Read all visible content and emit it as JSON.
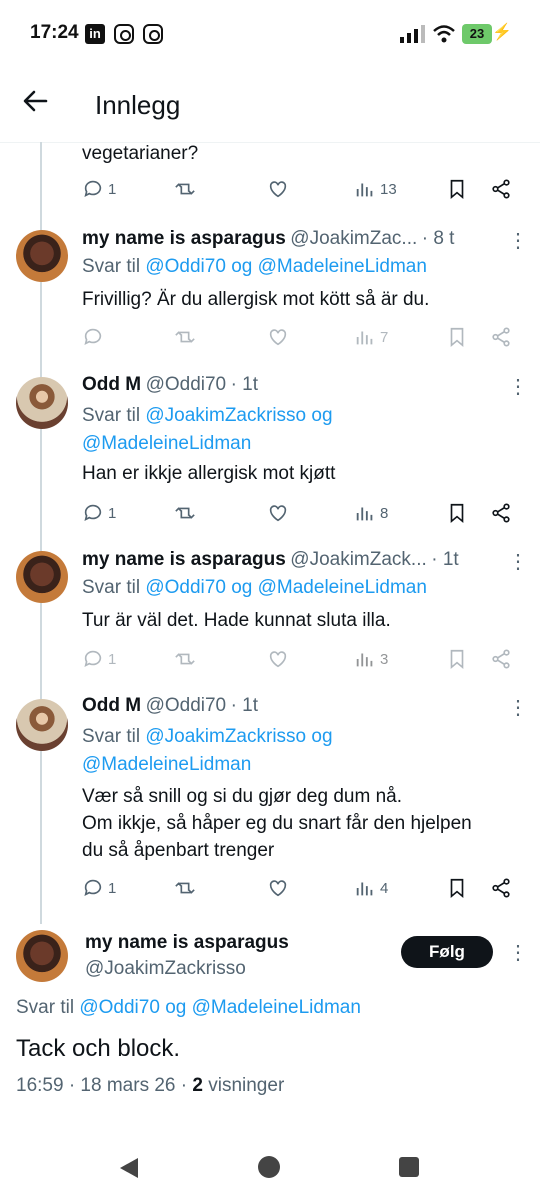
{
  "status_bar": {
    "time": "17:24",
    "app_icons": [
      "linkedin-icon",
      "instagram-icon",
      "instagram-icon"
    ],
    "battery": "23"
  },
  "header": {
    "title": "Innlegg"
  },
  "tweets": [
    {
      "text": "vegetarianer?",
      "stats": {
        "reply": "1",
        "retweet": "",
        "like": "",
        "views": "13"
      }
    },
    {
      "name": "my name is asparagus",
      "handle": "@JoakimZac...",
      "time": "· 8 t",
      "reply_prefix": "Svar til ",
      "reply_to_1": "@Oddi70",
      "reply_and": " og ",
      "reply_to_2": "@MadeleineLidman",
      "text": "Frivillig? Är du allergisk mot kött så är du.",
      "stats": {
        "reply": "",
        "retweet": "",
        "like": "",
        "views": "7"
      }
    },
    {
      "name": "Odd M",
      "handle": "@Oddi70",
      "time": "· 1t",
      "reply_prefix": "Svar til ",
      "reply_to_1": "@JoakimZackrisso",
      "reply_and": " og",
      "reply_to_2": "@MadeleineLidman",
      "text": "Han er ikkje allergisk mot kjøtt",
      "stats": {
        "reply": "1",
        "retweet": "",
        "like": "",
        "views": "8"
      }
    },
    {
      "name": "my name is asparagus",
      "handle": "@JoakimZack...",
      "time": "· 1t",
      "reply_prefix": "Svar til ",
      "reply_to_1": "@Oddi70",
      "reply_and": " og ",
      "reply_to_2": "@MadeleineLidman",
      "text": "Tur är väl det. Hade kunnat sluta illa.",
      "stats": {
        "reply": "1",
        "retweet": "",
        "like": "",
        "views": "3"
      }
    },
    {
      "name": "Odd M",
      "handle": "@Oddi70",
      "time": "· 1t",
      "reply_prefix": "Svar til ",
      "reply_to_1": "@JoakimZackrisso",
      "reply_and": " og",
      "reply_to_2": "@MadeleineLidman",
      "text_lines": [
        "Vær så snill og si du gjør deg dum nå.",
        "Om ikkje, så håper eg du snart får den hjelpen",
        "du så åpenbart trenger"
      ],
      "stats": {
        "reply": "1",
        "retweet": "",
        "like": "",
        "views": "4"
      }
    }
  ],
  "main_tweet": {
    "name": "my name is asparagus",
    "handle": "@JoakimZackrisso",
    "follow_label": "Følg",
    "reply_prefix": "Svar til ",
    "reply_to_1": "@Oddi70",
    "reply_and": " og ",
    "reply_to_2": "@MadeleineLidman",
    "text": "Tack och block.",
    "time": "16:59 · 18 mars 26 · ",
    "views_count": "2",
    "views_label": " visninger"
  },
  "colors": {
    "link": "#1d9bf0",
    "secondary": "#536471",
    "primary": "#0f1419"
  }
}
